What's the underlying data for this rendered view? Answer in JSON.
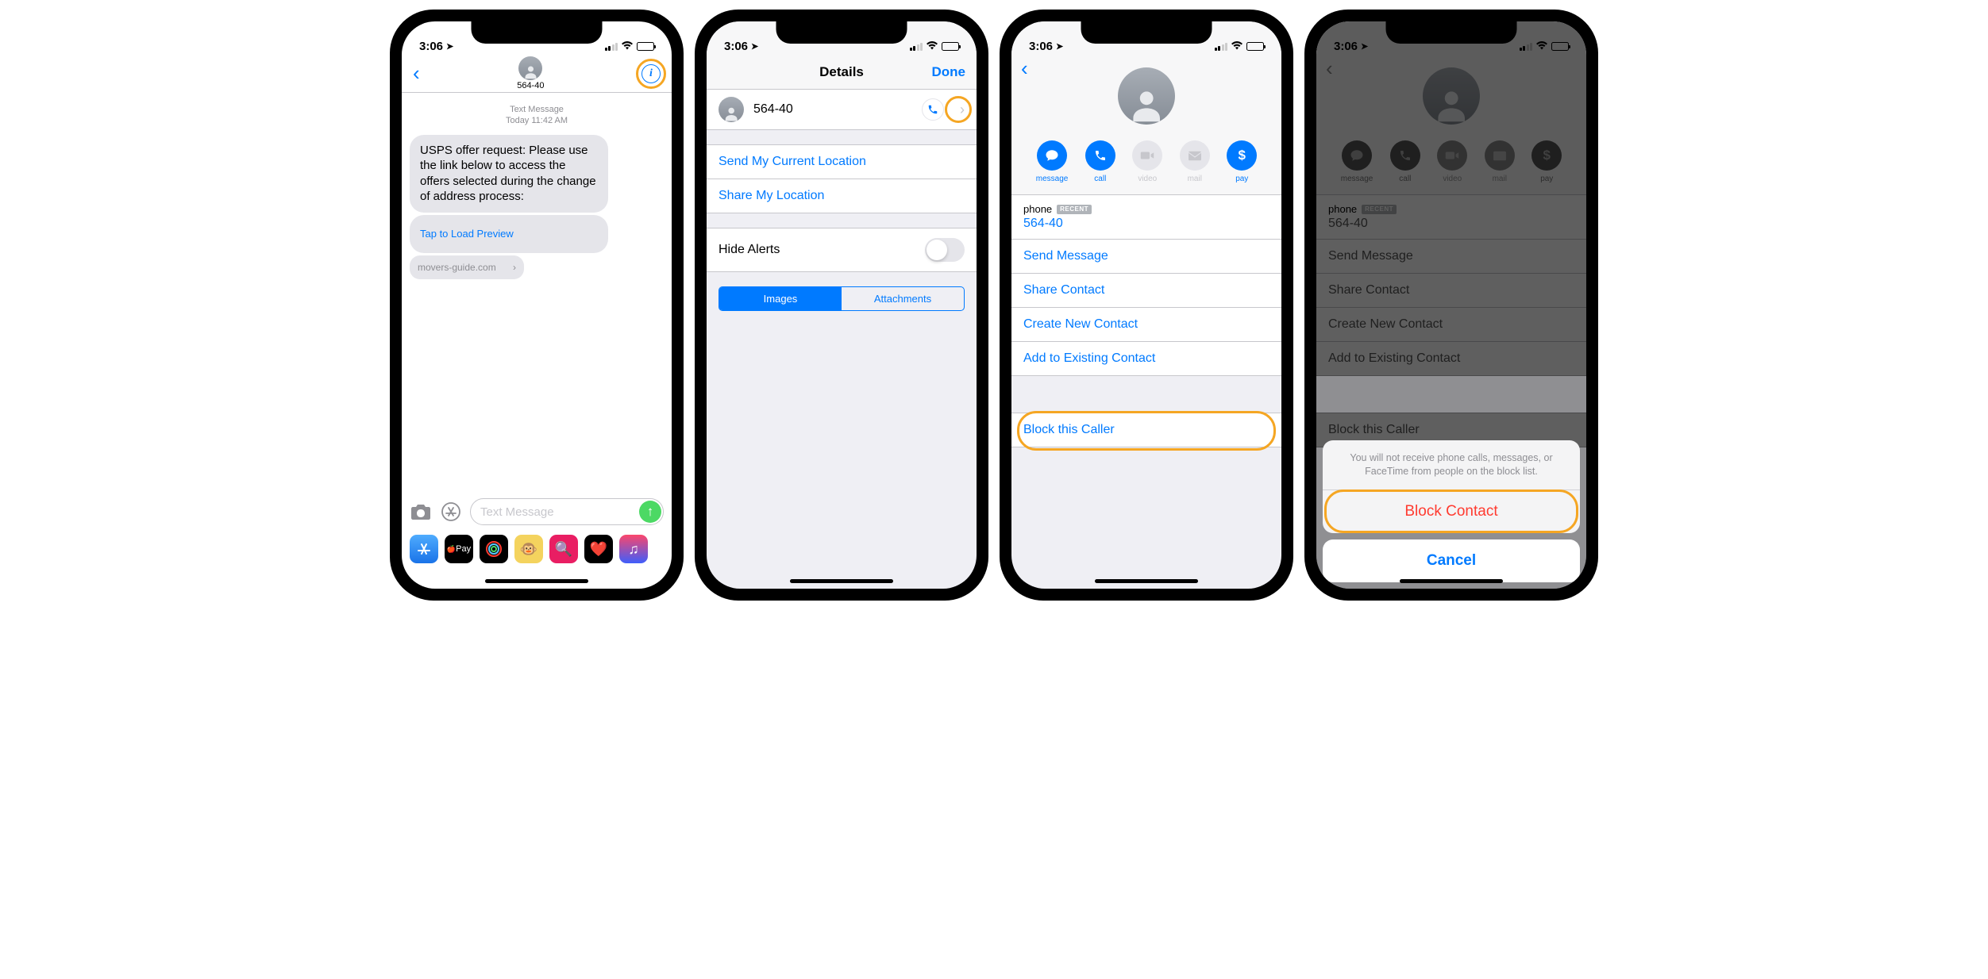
{
  "status": {
    "time": "3:06",
    "loc_indicator": "✈"
  },
  "s1": {
    "contact_number": "564-40",
    "meta_label": "Text Message",
    "meta_time": "Today 11:42 AM",
    "message_body": "USPS offer request: Please use the link below to access the offers selected during the change of address process:",
    "preview_cta": "Tap to Load Preview",
    "link_domain": "movers-guide.com",
    "input_placeholder": "Text Message",
    "dock_pay": "Pay"
  },
  "s2": {
    "title": "Details",
    "done": "Done",
    "contact": "564-40",
    "send_location": "Send My Current Location",
    "share_location": "Share My Location",
    "hide_alerts": "Hide Alerts",
    "seg_images": "Images",
    "seg_attachments": "Attachments"
  },
  "s3": {
    "actions": {
      "message": "message",
      "call": "call",
      "video": "video",
      "mail": "mail",
      "pay": "pay"
    },
    "phone_label": "phone",
    "recent_badge": "RECENT",
    "phone_value": "564-40",
    "send_message": "Send Message",
    "share_contact": "Share Contact",
    "create_contact": "Create New Contact",
    "add_existing": "Add to Existing Contact",
    "block_caller": "Block this Caller"
  },
  "s4": {
    "sheet_message": "You will not receive phone calls, messages, or FaceTime from people on the block list.",
    "block_contact": "Block Contact",
    "cancel": "Cancel"
  }
}
